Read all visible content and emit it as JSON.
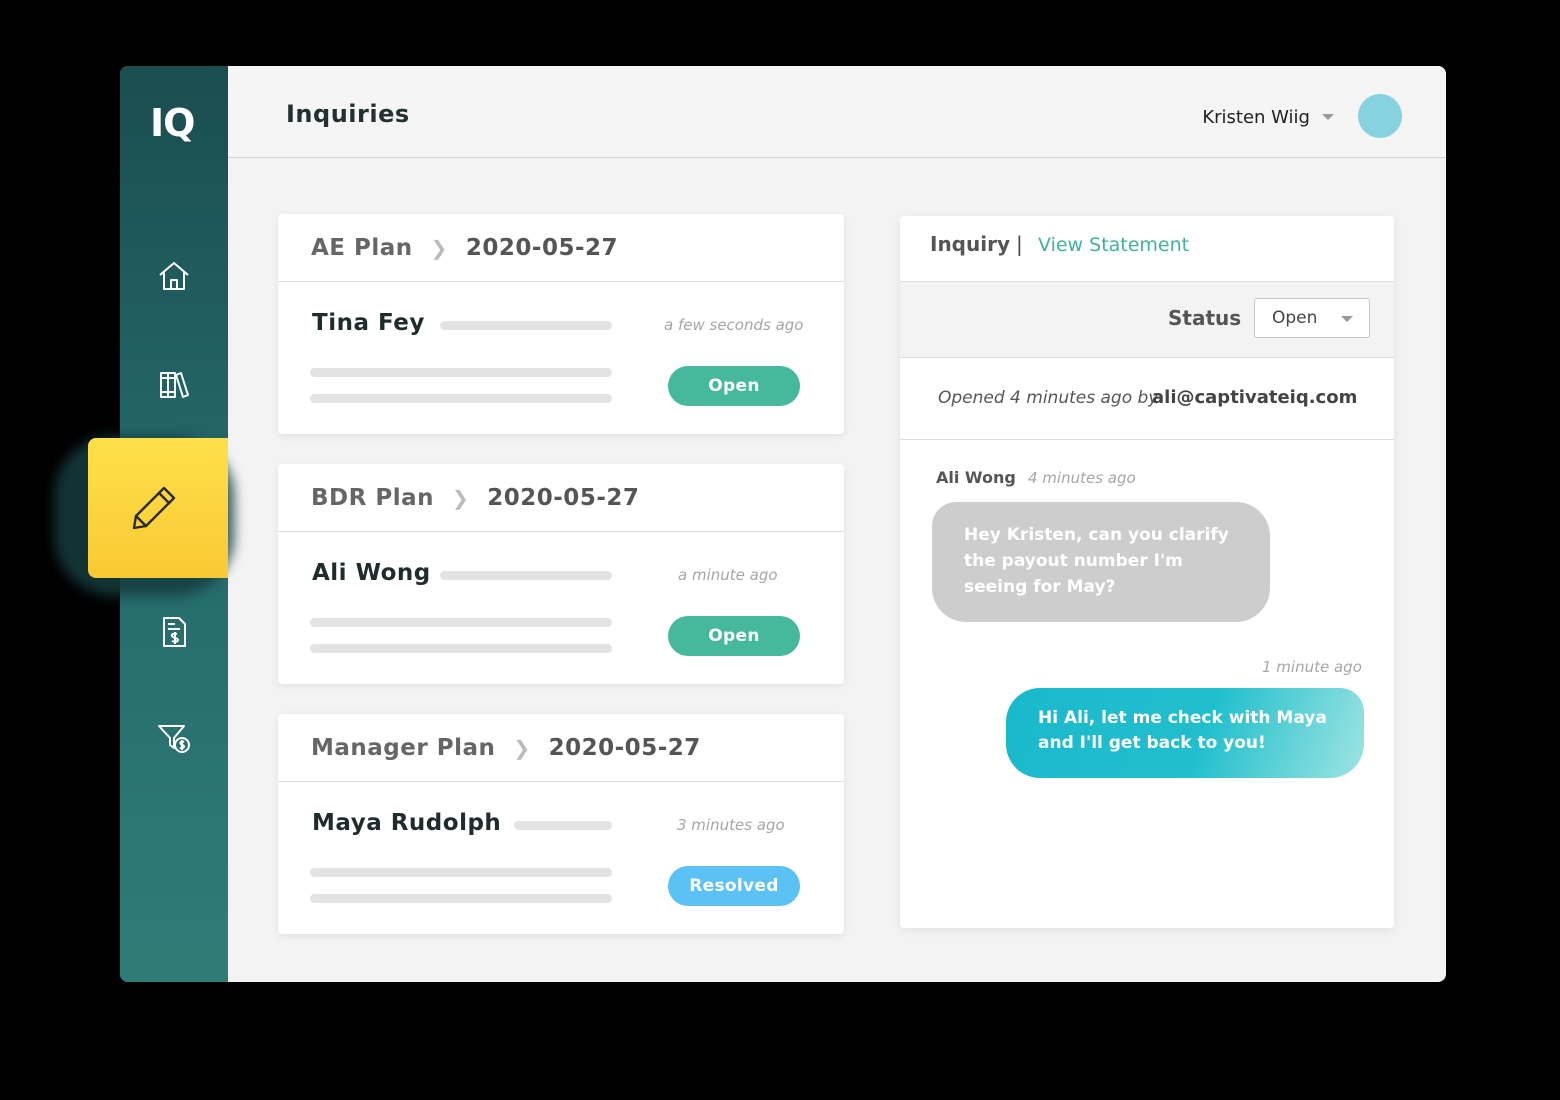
{
  "brand": {
    "logo": "IQ",
    "active_color": "#fdd43a",
    "accent": "#46b99d"
  },
  "sidebar": {
    "items": [
      {
        "name": "home",
        "icon": "home-icon"
      },
      {
        "name": "library",
        "icon": "books-icon"
      },
      {
        "name": "inquiries",
        "icon": "pencil-icon",
        "active": true
      },
      {
        "name": "statements",
        "icon": "dollar-document-icon"
      },
      {
        "name": "filter",
        "icon": "filter-dollar-icon"
      }
    ]
  },
  "header": {
    "title": "Inquiries",
    "user_name": "Kristen Wiig"
  },
  "inquiries": [
    {
      "plan": "AE Plan",
      "date": "2020-05-27",
      "person": "Tina Fey",
      "time": "a few seconds ago",
      "status": "Open"
    },
    {
      "plan": "BDR Plan",
      "date": "2020-05-27",
      "person": "Ali Wong",
      "time": "a minute ago",
      "status": "Open"
    },
    {
      "plan": "Manager Plan",
      "date": "2020-05-27",
      "person": "Maya Rudolph",
      "time": "3 minutes ago",
      "status": "Resolved"
    }
  ],
  "detail": {
    "tab_inquiry": "Inquiry",
    "tab_separator": "|",
    "tab_statement": "View Statement",
    "status_label": "Status",
    "status_value": "Open",
    "opened_text": "Opened 4 minutes ago by",
    "opened_by": "ali@captivateiq.com",
    "messages": [
      {
        "author": "Ali Wong",
        "time": "4 minutes ago",
        "text": "Hey Kristen, can you clarify the payout number I'm seeing for May?"
      },
      {
        "author": "",
        "time": "1 minute ago",
        "text": "Hi Ali, let me check with Maya and I'll get back to you!"
      }
    ]
  }
}
